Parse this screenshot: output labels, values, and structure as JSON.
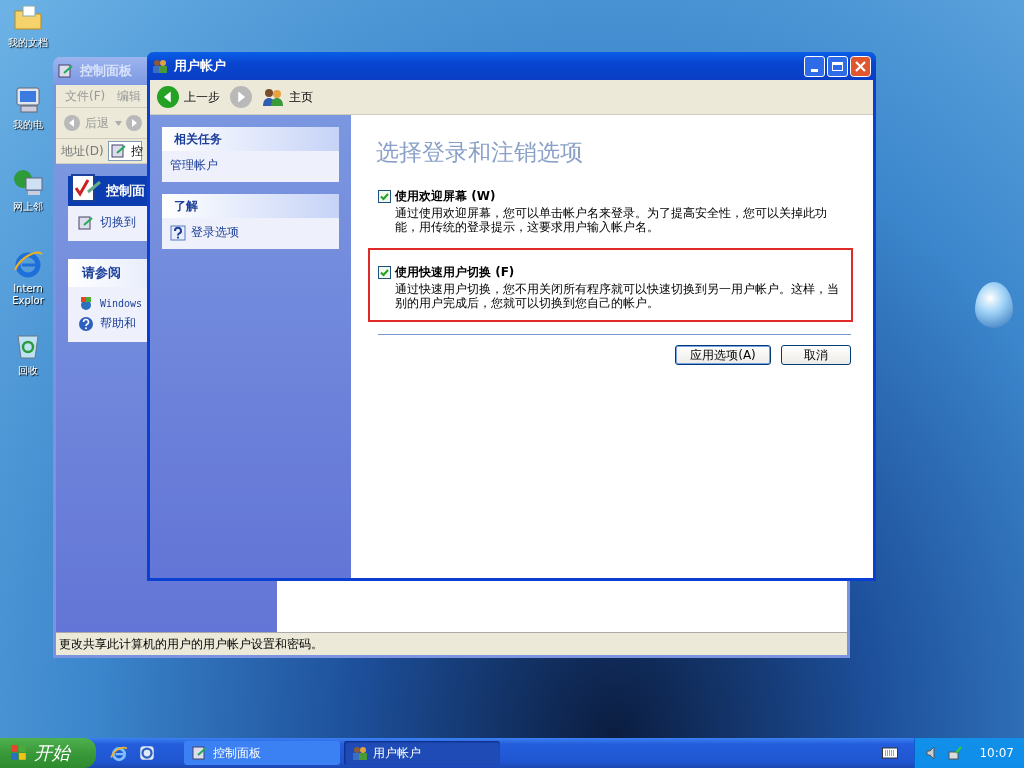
{
  "desktop_icons": [
    {
      "kind": "folder",
      "lines": [
        "我的文档"
      ]
    },
    {
      "kind": "computer",
      "lines": [
        "我的电"
      ]
    },
    {
      "kind": "network",
      "lines": [
        "网上邻"
      ]
    },
    {
      "kind": "browser",
      "lines": [
        "Intern",
        "Explor"
      ]
    },
    {
      "kind": "recycle",
      "lines": [
        "回收"
      ]
    }
  ],
  "back_window": {
    "title": "控制面板",
    "menu": [
      "文件(F)",
      "编辑"
    ],
    "back_label": "后退",
    "address_label": "地址(D)",
    "address_value": "控",
    "panels": [
      {
        "kind": "header",
        "title": "控制面",
        "items": [
          {
            "kind": "switch",
            "label": "切换到"
          }
        ]
      },
      {
        "kind": "plain",
        "title": "请参阅",
        "items": [
          {
            "kind": "windows",
            "label": "Windows"
          },
          {
            "kind": "help",
            "label": "帮助和"
          }
        ]
      }
    ],
    "status_bar": "更改共享此计算机的用户的用户帐户设置和密码。"
  },
  "front_window": {
    "title": "用户帐户",
    "back_label": "上一步",
    "home_label": "主页",
    "sidebar": [
      {
        "title": "相关任务",
        "items": [
          {
            "kind": "plain",
            "label": "管理帐户"
          }
        ]
      },
      {
        "title": "了解",
        "items": [
          {
            "kind": "help",
            "label": "登录选项"
          }
        ]
      }
    ],
    "heading": "选择登录和注销选项",
    "options": [
      {
        "label": "使用欢迎屏幕 (W)",
        "description": "通过使用欢迎屏幕，您可以单击帐户名来登录。为了提高安全性，您可以关掉此功能，用传统的登录提示，这要求用户输入帐户名。",
        "checked": true,
        "highlighted": false
      },
      {
        "label": "使用快速用户切换 (F)",
        "description": "通过快速用户切换，您不用关闭所有程序就可以快速切换到另一用户帐户。这样，当别的用户完成后，您就可以切换到您自己的帐户。",
        "checked": true,
        "highlighted": true
      }
    ],
    "buttons": [
      "应用选项(A)",
      "取消"
    ]
  },
  "taskbar": {
    "start": "开始",
    "tasks": [
      {
        "kind": "control-panel",
        "label": "控制面板",
        "selected": false
      },
      {
        "kind": "users",
        "label": "用户帐户",
        "selected": true
      }
    ],
    "clock": "10:07"
  }
}
